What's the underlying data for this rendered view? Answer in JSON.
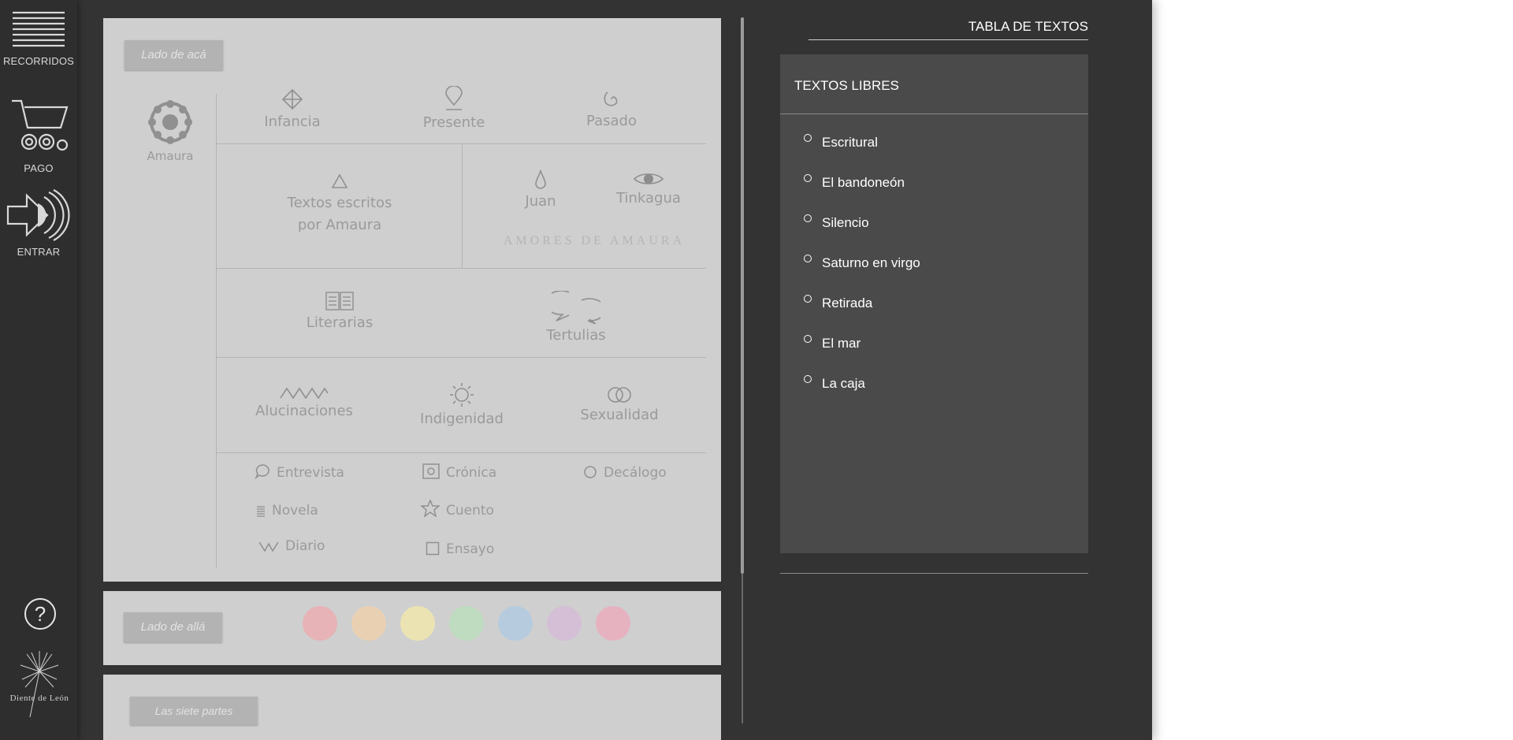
{
  "nav": {
    "items": [
      {
        "label": "RECORRIDOS",
        "icon": "menu-lines-icon"
      },
      {
        "label": "PAGO",
        "icon": "cart-spiral-icon"
      },
      {
        "label": "ENTRAR",
        "icon": "arrow-enter-icon"
      }
    ],
    "help_label": "?",
    "logo_text": "Diente de León"
  },
  "main": {
    "lado_aca_label": "Lado de acá",
    "amaura_label": "Amaura",
    "row1": [
      {
        "label": "Infancia",
        "icon": "diamond-cross-icon"
      },
      {
        "label": "Presente",
        "icon": "pin-icon"
      },
      {
        "label": "Pasado",
        "icon": "spiral-icon"
      }
    ],
    "textos_escritos": {
      "line1": "Textos escritos",
      "line2": "por Amaura",
      "icon": "triangle-icon"
    },
    "amores": {
      "items": [
        {
          "label": "Juan",
          "icon": "drop-icon"
        },
        {
          "label": "Tinkagua",
          "icon": "eye-icon"
        }
      ],
      "caption": "AMORES DE AMAURA"
    },
    "row3": [
      {
        "label": "Literarias",
        "icon": "book-icon"
      },
      {
        "label": "Tertulias",
        "icon": "speech-bubbles-icon"
      }
    ],
    "row4": [
      {
        "label": "Alucinaciones",
        "icon": "zigzag-icon"
      },
      {
        "label": "Indigenidad",
        "icon": "sun-icon"
      },
      {
        "label": "Sexualidad",
        "icon": "rings-icon"
      }
    ],
    "genres": {
      "entrevista": "Entrevista",
      "cronica": "Crónica",
      "decalogo": "Decálogo",
      "novela": "Novela",
      "cuento": "Cuento",
      "diario": "Diario",
      "ensayo": "Ensayo"
    },
    "lado_alla_label": "Lado de allá",
    "color_dots": [
      "#e7b3b6",
      "#ead0b3",
      "#ece3b3",
      "#bfdcc0",
      "#b6ccde",
      "#d4bfd6",
      "#e6b2c0"
    ],
    "siete_partes_label": "Las siete partes"
  },
  "right": {
    "title": "TABLA DE TEXTOS",
    "section_title": "TEXTOS LIBRES",
    "items": [
      "Escritural",
      "El bandoneón",
      "Silencio",
      "Saturno en virgo",
      "Retirada",
      "El mar",
      "La caja"
    ]
  }
}
